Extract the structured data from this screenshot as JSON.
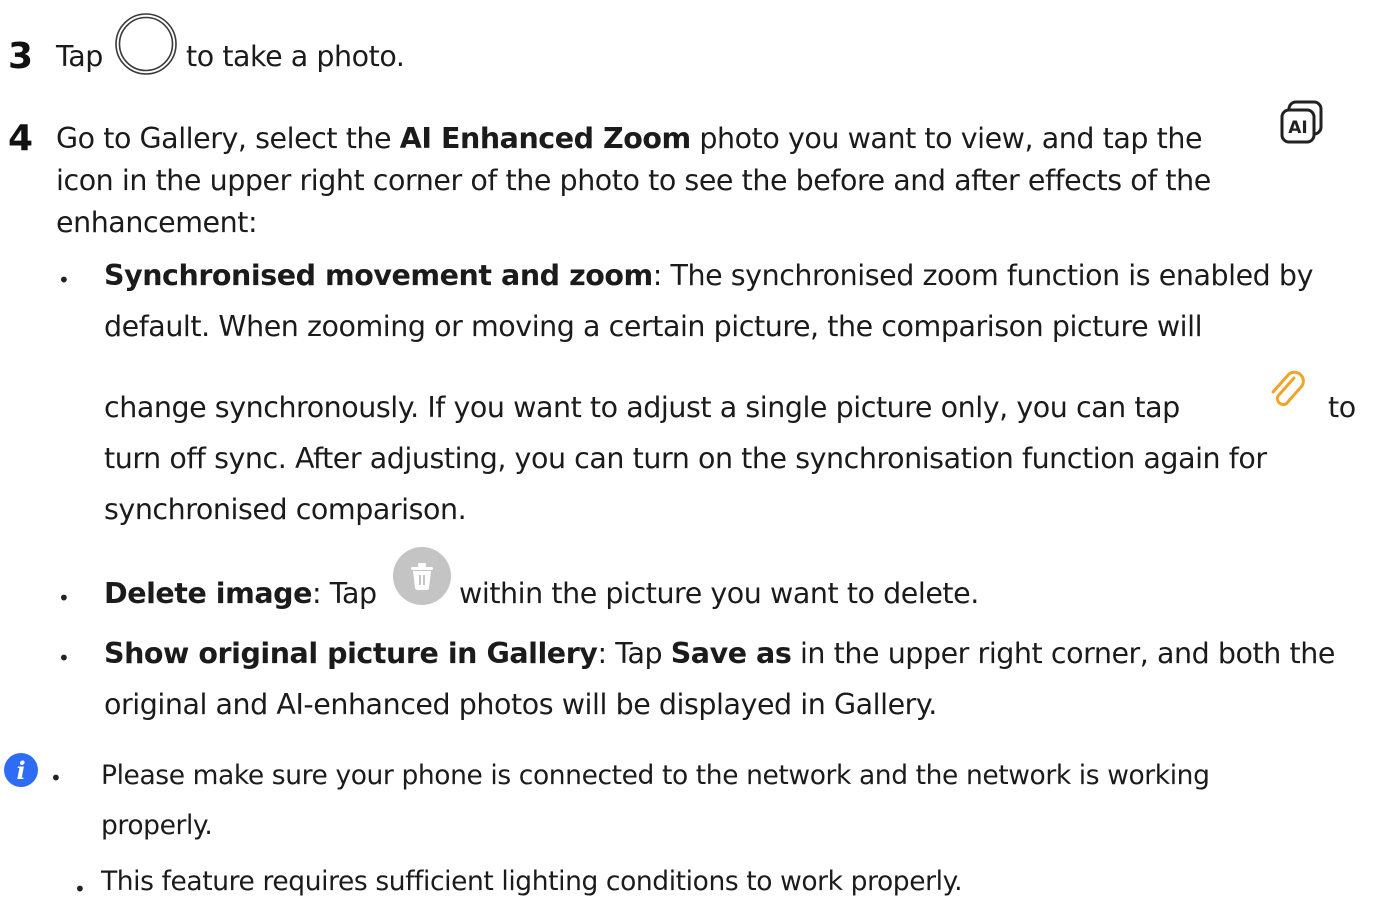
{
  "step3": {
    "number": "3",
    "pre": "Tap",
    "post": "to take a photo.",
    "icon": "shutter-icon"
  },
  "step4": {
    "number": "4",
    "l1_pre": "Go to Gallery, select the ",
    "l1_bold": "AI Enhanced Zoom",
    "l1_post": " photo you want to view, and tap the",
    "l2": "icon in the upper right corner of the photo to see the before and after effects of the",
    "l3": "enhancement:",
    "icon": "ai-compare-icon"
  },
  "bullets": {
    "sync": {
      "title": "Synchronised movement and zoom",
      "l1_rest": ": The synchronised zoom function is enabled by",
      "l2": "default. When zooming or moving a certain picture, the comparison picture will",
      "l3_pre": "change synchronously. If you want to adjust a single picture only, you can tap",
      "l3_post": "to",
      "l4": "turn off sync. After adjusting, you can turn on the synchronisation function again for",
      "l5": "synchronised comparison.",
      "icon": "link-icon"
    },
    "delete": {
      "title": "Delete image",
      "pre": ": Tap",
      "post": "within the picture you want to delete.",
      "icon": "trash-icon"
    },
    "original": {
      "title": "Show original picture in Gallery",
      "mid1": ": Tap ",
      "bold2": "Save as",
      "mid2": " in the upper right corner, and both the",
      "l2": "original and AI-enhanced photos will be displayed in Gallery."
    }
  },
  "notes": {
    "icon": "info-icon",
    "n1_l1": "Please make sure your phone is connected to the network and the network is working",
    "n1_l2": "properly.",
    "n2": "This feature requires sufficient lighting conditions to work properly."
  },
  "bullet_char": "•",
  "colors": {
    "text": "#1b1b1b",
    "info_blue": "#2f6cf5",
    "link_orange": "#f0a42a",
    "trash_gray": "#c4c4c4"
  }
}
